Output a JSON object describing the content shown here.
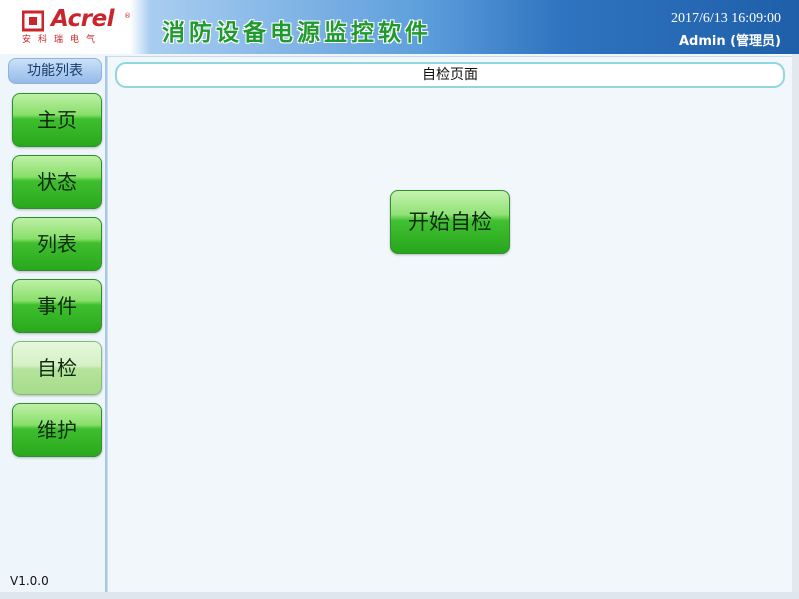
{
  "header": {
    "logo": {
      "brand": "Acrel",
      "registered": "®",
      "subtitle": "安科瑞电气",
      "brand_color": "#c8262c"
    },
    "title": "消防设备电源监控软件",
    "title_color": "#1f9a2e",
    "datetime": "2017/6/13 16:09:00",
    "user": "Admin (管理员)"
  },
  "sidebar": {
    "title": "功能列表",
    "items": [
      {
        "label": "主页",
        "active": false
      },
      {
        "label": "状态",
        "active": false
      },
      {
        "label": "列表",
        "active": false
      },
      {
        "label": "事件",
        "active": false
      },
      {
        "label": "自检",
        "active": true
      },
      {
        "label": "维护",
        "active": false
      }
    ],
    "version": "V1.0.0"
  },
  "main": {
    "page_title": "自检页面",
    "start_button_label": "开始自检"
  },
  "colors": {
    "button_green": "#29a81d",
    "header_blue": "#2f74c0",
    "page_background": "#eef5fb"
  }
}
